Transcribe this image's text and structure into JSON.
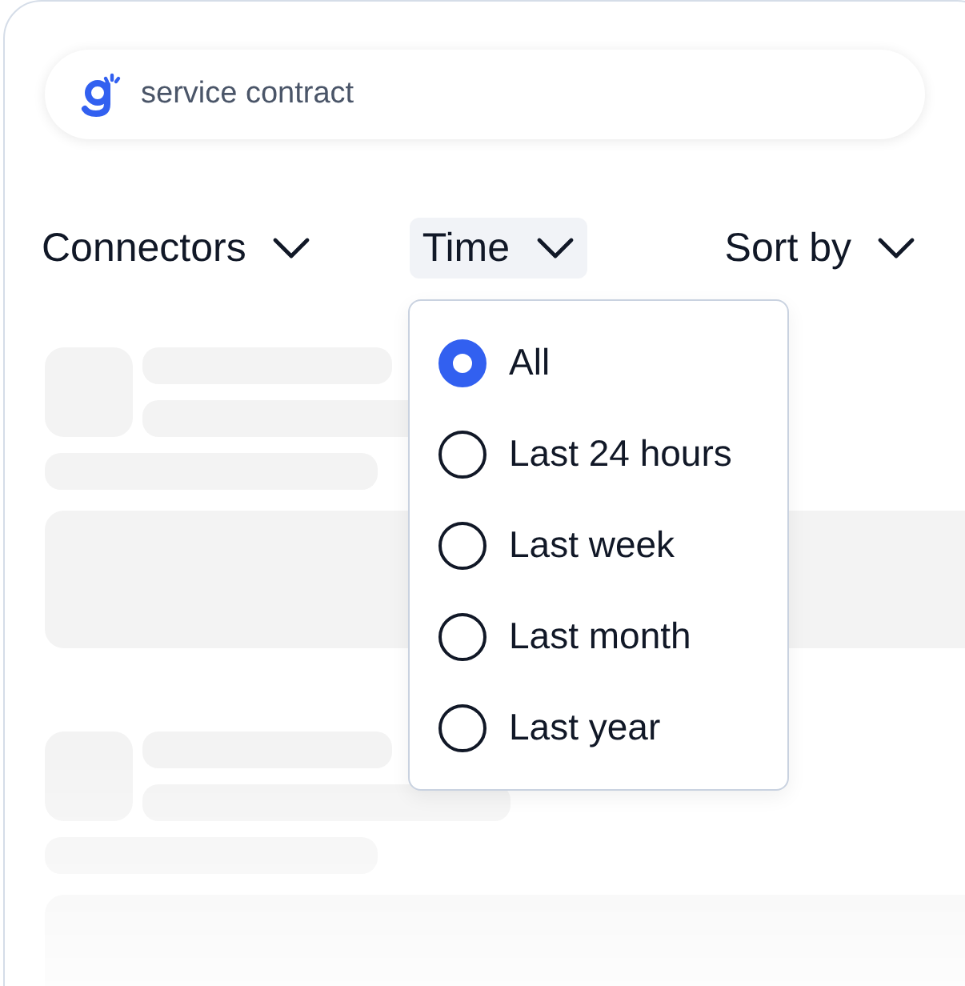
{
  "search": {
    "value": "service contract"
  },
  "filters": [
    {
      "label": "Connectors",
      "expanded": false
    },
    {
      "label": "Time",
      "expanded": true
    },
    {
      "label": "Sort by",
      "expanded": false
    }
  ],
  "time_menu": {
    "options": [
      {
        "label": "All",
        "selected": true
      },
      {
        "label": "Last 24 hours",
        "selected": false
      },
      {
        "label": "Last week",
        "selected": false
      },
      {
        "label": "Last month",
        "selected": false
      },
      {
        "label": "Last year",
        "selected": false
      }
    ]
  }
}
